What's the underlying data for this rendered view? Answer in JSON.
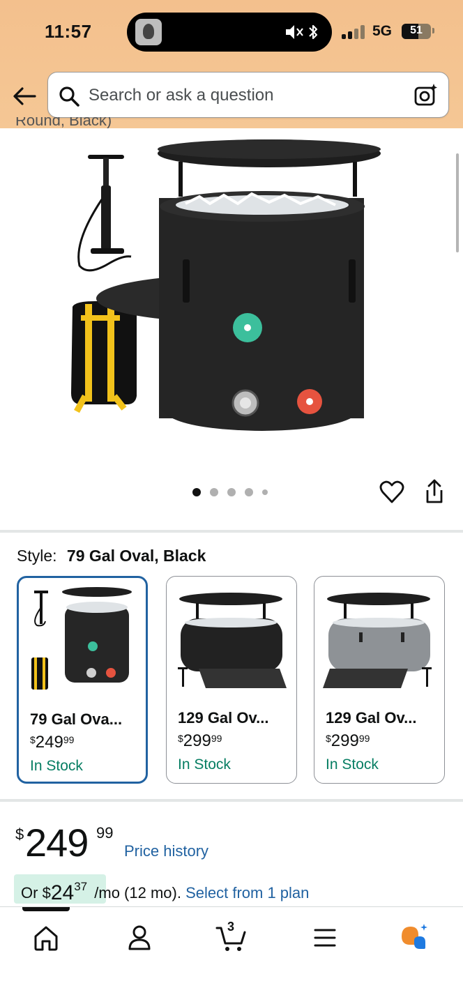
{
  "status_bar": {
    "time": "11:57",
    "network": "5G",
    "battery": "51"
  },
  "header": {
    "search_placeholder": "Search or ask a question",
    "partial_title": "Round, Black)"
  },
  "gallery": {
    "image_count": 5,
    "active_index": 0
  },
  "style": {
    "label": "Style:",
    "selected_value": "79 Gal Oval, Black",
    "variants": [
      {
        "name": "79 Gal Ova...",
        "price_symbol": "$",
        "price_whole": "249",
        "price_cents": "99",
        "stock": "In Stock",
        "selected": true
      },
      {
        "name": "129 Gal Ov...",
        "price_symbol": "$",
        "price_whole": "299",
        "price_cents": "99",
        "stock": "In Stock",
        "selected": false
      },
      {
        "name": "129 Gal Ov...",
        "price_symbol": "$",
        "price_whole": "299",
        "price_cents": "99",
        "stock": "In Stock",
        "selected": false
      }
    ]
  },
  "price": {
    "symbol": "$",
    "whole": "249",
    "cents": "99",
    "history_link": "Price history"
  },
  "monthly": {
    "prefix": "Or",
    "symbol": "$",
    "whole": "24",
    "cents": "37",
    "term": "/mo (12 mo).",
    "plan_link": "Select from 1 plan"
  },
  "bottom_nav": {
    "cart_count": "3",
    "items": [
      "home-icon",
      "account-icon",
      "cart-icon",
      "menu-icon",
      "rufus-ai-icon"
    ]
  },
  "colors": {
    "header_bg": "#f3c08d",
    "link": "#2162a1",
    "in_stock": "#067d62",
    "selected_border": "#2162a1",
    "monthly_highlight": "#d5f1e6"
  }
}
